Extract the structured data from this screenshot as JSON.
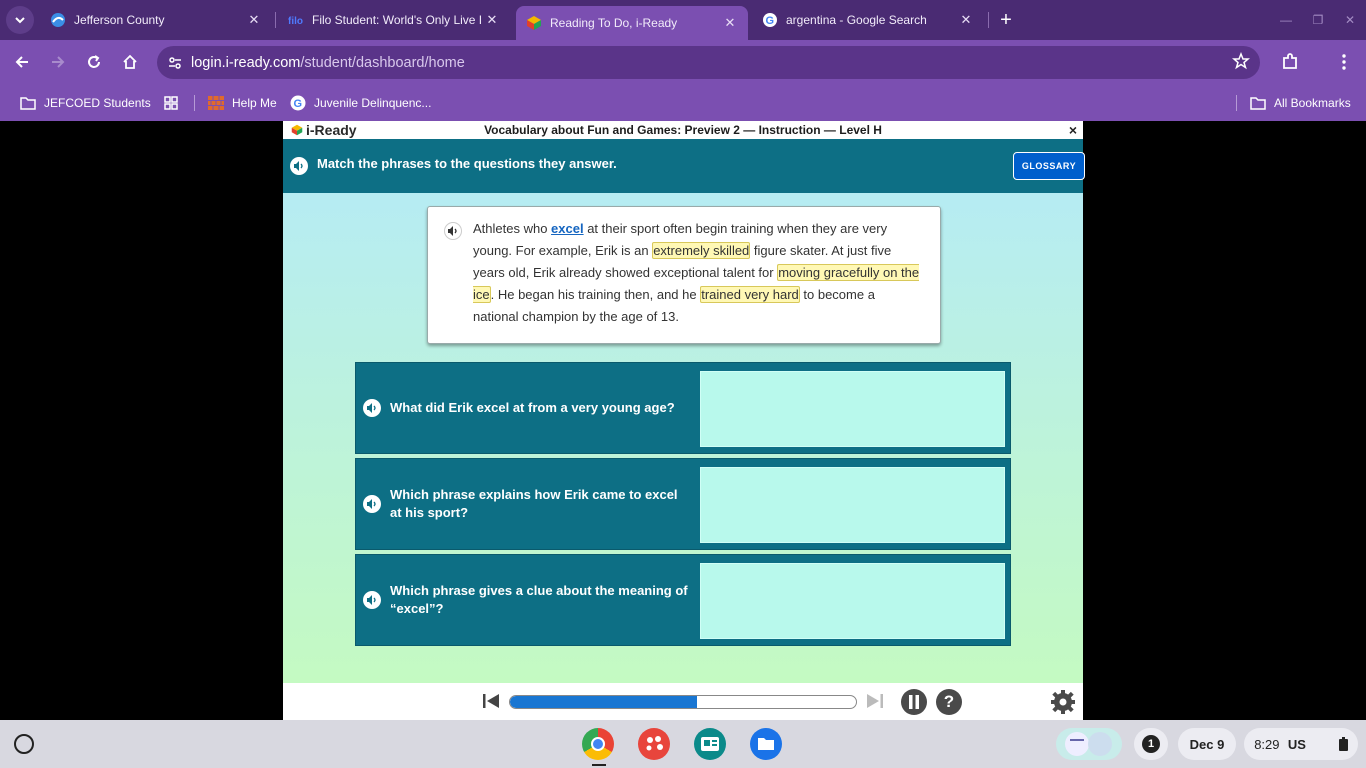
{
  "browser": {
    "tabs": [
      {
        "title": "Jefferson County"
      },
      {
        "title": "Filo Student: World's Only Live I"
      },
      {
        "title": "Reading To Do, i-Ready"
      },
      {
        "title": "argentina - Google Search"
      }
    ],
    "url_domain": "login.i-ready.com",
    "url_path": "/student/dashboard/home",
    "bookmarks": [
      {
        "label": "JEFCOED Students"
      },
      {
        "label": "Help Me"
      },
      {
        "label": "Juvenile Delinquenc..."
      }
    ],
    "all_bookmarks": "All Bookmarks"
  },
  "lesson": {
    "logo": "i-Ready",
    "title": "Vocabulary about Fun and Games: Preview 2 — Instruction — Level H",
    "close": "×",
    "instruction": "Match the phrases to the questions they answer.",
    "glossary_label": "GLOSSARY",
    "passage": {
      "p1": "Athletes who ",
      "keyword": "excel",
      "p2": " at their sport often begin training when they are very young. For example, Erik is an ",
      "h1": "extremely skilled",
      "p3": " figure skater. At just five years old, Erik already showed exceptional talent for ",
      "h2": "moving gracefully on the ice",
      "p4": ". He began his training then, and he ",
      "h3": "trained very hard",
      "p5": " to become a national champion by the age of 13."
    },
    "questions": [
      {
        "text": "What did Erik excel at from a very young age?"
      },
      {
        "text": "Which phrase explains how Erik came to excel at his sport?"
      },
      {
        "text": "Which phrase gives a clue about the meaning of “excel”?"
      }
    ],
    "progress_percent": 54
  },
  "shelf": {
    "notification_count": "1",
    "date": "Dec 9",
    "time": "8:29",
    "locale": "US"
  }
}
